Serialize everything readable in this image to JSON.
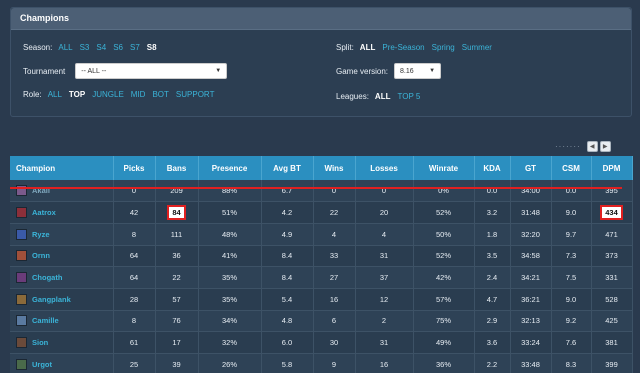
{
  "panel": {
    "title": "Champions"
  },
  "season": {
    "label": "Season:",
    "options": [
      "ALL",
      "S3",
      "S4",
      "S6",
      "S7",
      "S8"
    ],
    "active": "S8"
  },
  "split": {
    "label": "Split:",
    "options": [
      "ALL",
      "Pre-Season",
      "Spring",
      "Summer"
    ],
    "active": "ALL"
  },
  "tournament": {
    "label": "Tournament",
    "value": "-- ALL --"
  },
  "game_version": {
    "label": "Game version:",
    "value": "8.16"
  },
  "role": {
    "label": "Role:",
    "options": [
      "ALL",
      "TOP",
      "JUNGLE",
      "MID",
      "BOT",
      "SUPPORT"
    ],
    "active": "TOP"
  },
  "leagues": {
    "label": "Leagues:",
    "options": [
      "ALL",
      "TOP 5"
    ],
    "active": "ALL"
  },
  "pager": {
    "prev_icon": "chevron-left-icon",
    "next_icon": "chevron-right-icon"
  },
  "table": {
    "headers": [
      "Champion",
      "Picks",
      "Bans",
      "Presence",
      "Avg BT",
      "Wins",
      "Losses",
      "Winrate",
      "KDA",
      "GT",
      "CSM",
      "DPM"
    ],
    "rows": [
      {
        "champion": "Akali",
        "picks": "0",
        "bans": "209",
        "presence": "88%",
        "avg_bt": "6.7",
        "wins": "0",
        "losses": "0",
        "winrate": "0%",
        "kda": "0.0",
        "gt": "34:00",
        "csm": "0.0",
        "dpm": "395",
        "color": "#7b5a8c"
      },
      {
        "champion": "Aatrox",
        "picks": "42",
        "bans": "84",
        "presence": "51%",
        "avg_bt": "4.2",
        "wins": "22",
        "losses": "20",
        "winrate": "52%",
        "kda": "3.2",
        "gt": "31:48",
        "csm": "9.0",
        "dpm": "434",
        "color": "#8c2f3a"
      },
      {
        "champion": "Ryze",
        "picks": "8",
        "bans": "111",
        "presence": "48%",
        "avg_bt": "4.9",
        "wins": "4",
        "losses": "4",
        "winrate": "50%",
        "kda": "1.8",
        "gt": "32:20",
        "csm": "9.7",
        "dpm": "471",
        "color": "#3a5aa8"
      },
      {
        "champion": "Ornn",
        "picks": "64",
        "bans": "36",
        "presence": "41%",
        "avg_bt": "8.4",
        "wins": "33",
        "losses": "31",
        "winrate": "52%",
        "kda": "3.5",
        "gt": "34:58",
        "csm": "7.3",
        "dpm": "373",
        "color": "#a0503a"
      },
      {
        "champion": "Chogath",
        "picks": "64",
        "bans": "22",
        "presence": "35%",
        "avg_bt": "8.4",
        "wins": "27",
        "losses": "37",
        "winrate": "42%",
        "kda": "2.4",
        "gt": "34:21",
        "csm": "7.5",
        "dpm": "331",
        "color": "#6a3c7a"
      },
      {
        "champion": "Gangplank",
        "picks": "28",
        "bans": "57",
        "presence": "35%",
        "avg_bt": "5.4",
        "wins": "16",
        "losses": "12",
        "winrate": "57%",
        "kda": "4.7",
        "gt": "36:21",
        "csm": "9.0",
        "dpm": "528",
        "color": "#8a6a3a"
      },
      {
        "champion": "Camille",
        "picks": "8",
        "bans": "76",
        "presence": "34%",
        "avg_bt": "4.8",
        "wins": "6",
        "losses": "2",
        "winrate": "75%",
        "kda": "2.9",
        "gt": "32:13",
        "csm": "9.2",
        "dpm": "425",
        "color": "#5a7aa0"
      },
      {
        "champion": "Sion",
        "picks": "61",
        "bans": "17",
        "presence": "32%",
        "avg_bt": "6.0",
        "wins": "30",
        "losses": "31",
        "winrate": "49%",
        "kda": "3.6",
        "gt": "33:24",
        "csm": "7.6",
        "dpm": "381",
        "color": "#6a4a3a"
      },
      {
        "champion": "Urgot",
        "picks": "25",
        "bans": "39",
        "presence": "26%",
        "avg_bt": "5.8",
        "wins": "9",
        "losses": "16",
        "winrate": "36%",
        "kda": "2.2",
        "gt": "33:48",
        "csm": "8.3",
        "dpm": "399",
        "color": "#4a6a4a"
      }
    ]
  },
  "highlights": {
    "color": "#e02020",
    "aatrox_bans": "84",
    "aatrox_dpm": "434"
  }
}
